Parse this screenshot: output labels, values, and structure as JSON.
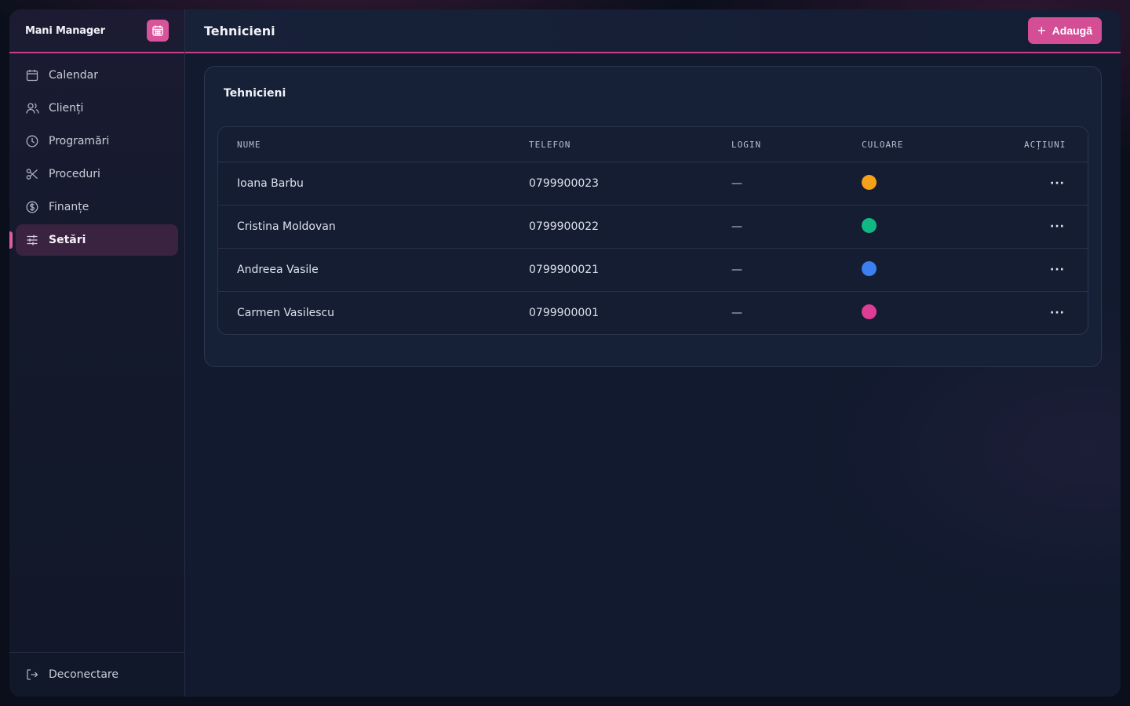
{
  "brand": {
    "name": "Mani Manager",
    "badge_icon": "calendar-icon",
    "accent": "#d9539a"
  },
  "sidebar": {
    "items": [
      {
        "label": "Calendar",
        "icon": "calendar-icon",
        "active": false
      },
      {
        "label": "Clienți",
        "icon": "users-icon",
        "active": false
      },
      {
        "label": "Programări",
        "icon": "clock-icon",
        "active": false
      },
      {
        "label": "Proceduri",
        "icon": "scissors-icon",
        "active": false
      },
      {
        "label": "Finanțe",
        "icon": "dollar-icon",
        "active": false
      },
      {
        "label": "Setări",
        "icon": "sliders-icon",
        "active": true
      }
    ],
    "footer": {
      "label": "Deconectare",
      "icon": "logout-icon"
    }
  },
  "header": {
    "title": "Tehnicieni",
    "add_label": "Adaugă"
  },
  "card": {
    "title": "Tehnicieni"
  },
  "table": {
    "columns": [
      "NUME",
      "TELEFON",
      "LOGIN",
      "CULOARE",
      "ACȚIUNI"
    ],
    "rows": [
      {
        "name": "Ioana Barbu",
        "phone": "0799900023",
        "login": "—",
        "color": "#f5a01a",
        "actions": "···"
      },
      {
        "name": "Cristina Moldovan",
        "phone": "0799900022",
        "login": "—",
        "color": "#12b883",
        "actions": "···"
      },
      {
        "name": "Andreea Vasile",
        "phone": "0799900021",
        "login": "—",
        "color": "#3b7ff0",
        "actions": "···"
      },
      {
        "name": "Carmen Vasilescu",
        "phone": "0799900001",
        "login": "—",
        "color": "#de3d93",
        "actions": "···"
      }
    ]
  }
}
